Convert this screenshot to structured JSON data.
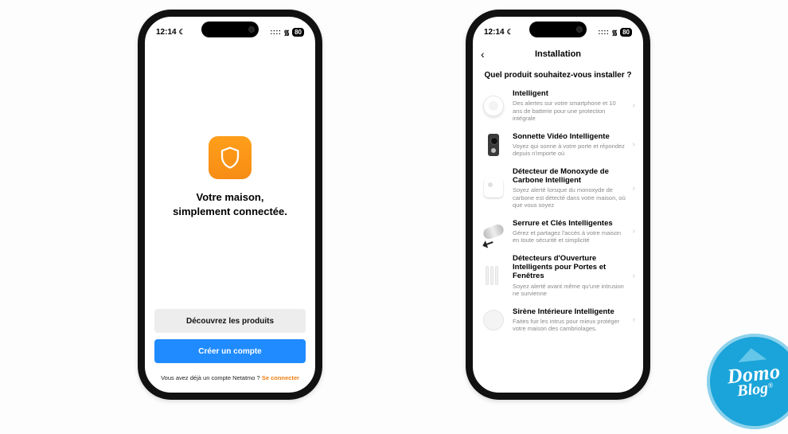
{
  "status": {
    "time": "12:14",
    "moon_icon": "☾",
    "signal_icon": "::::",
    "wifi_icon": "᯾",
    "battery": "80"
  },
  "welcome": {
    "headline_line1": "Votre maison,",
    "headline_line2": "simplement connectée.",
    "discover_label": "Découvrez les produits",
    "create_label": "Créer un compte",
    "login_prompt": "Vous avez déjà un compte Netatmo ?",
    "login_link": "Se connecter",
    "app_icon_name": "shield-icon",
    "accent_color": "#f78c15",
    "primary_color": "#1f8bff"
  },
  "install": {
    "nav_title": "Installation",
    "back_icon": "‹",
    "question": "Quel produit souhaitez-vous installer ?",
    "items": [
      {
        "title": "Intelligent",
        "desc": "Des alertes sur votre smartphone et 10 ans de batterie pour une protection intégrale",
        "thumb": "p-smoke",
        "name": "product-smoke-detector"
      },
      {
        "title": "Sonnette Vidéo Intelligente",
        "desc": "Voyez qui sonne à votre porte et répondez depuis n'importe où",
        "thumb": "p-bell",
        "name": "product-video-doorbell"
      },
      {
        "title": "Détecteur de Monoxyde de Carbone Intelligent",
        "desc": "Soyez alerté lorsque du monoxyde de carbone est détecté dans votre maison, où que vous soyez",
        "thumb": "p-co",
        "name": "product-co-detector"
      },
      {
        "title": "Serrure et Clés Intelligentes",
        "desc": "Gérez et partagez l'accès à votre maison en toute sécurité et simplicité",
        "thumb": "p-lock",
        "name": "product-smart-lock"
      },
      {
        "title": "Détecteurs d'Ouverture Intelligents pour Portes et Fenêtres",
        "desc": "Soyez alerté avant même qu'une intrusion ne survienne",
        "thumb": "p-door",
        "name": "product-door-window-sensor"
      },
      {
        "title": "Sirène Intérieure Intelligente",
        "desc": "Faites fuir les intrus pour mieux protéger votre maison des cambriolages.",
        "thumb": "p-siren",
        "name": "product-indoor-siren"
      }
    ]
  },
  "watermark": {
    "line1": "Domo",
    "line2": "Blog",
    "reg": "®"
  }
}
